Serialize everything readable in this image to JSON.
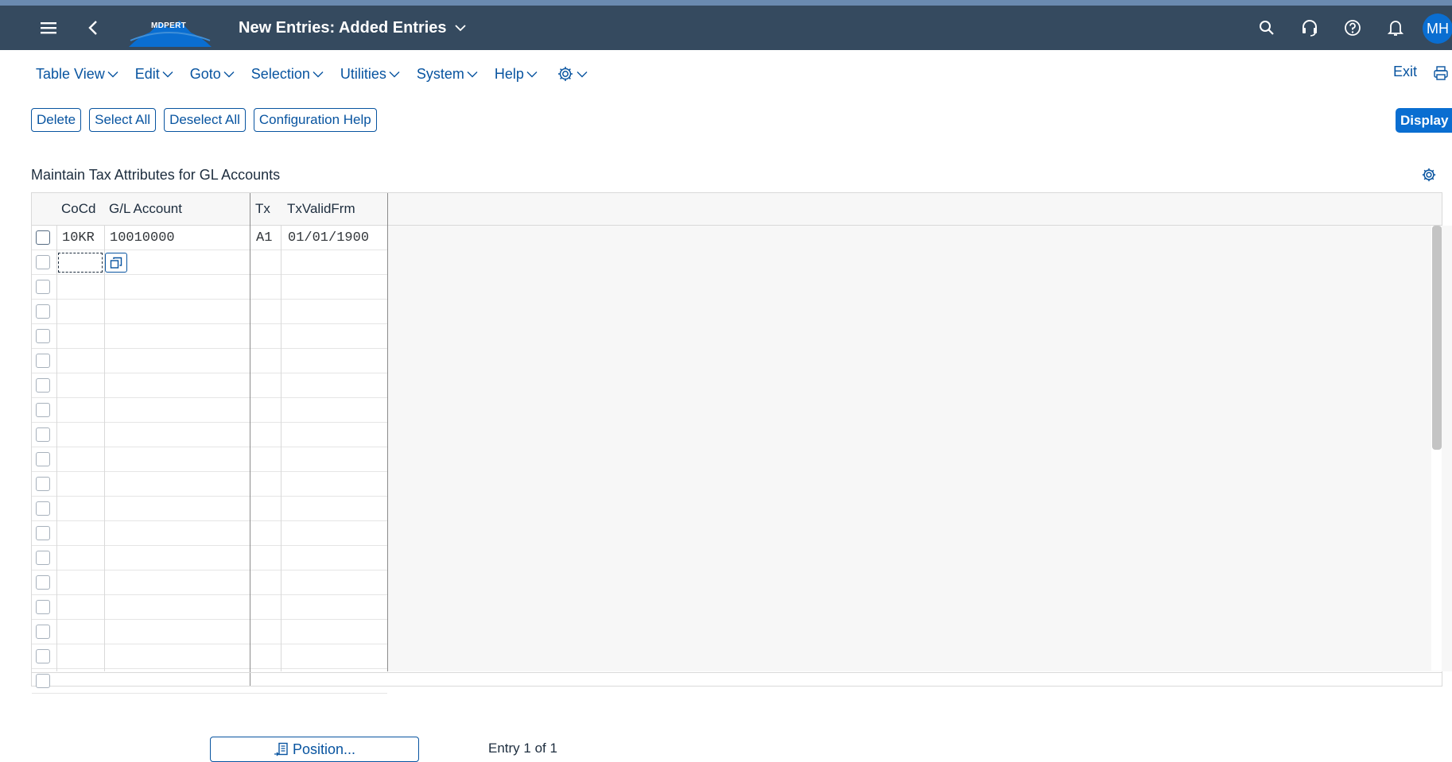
{
  "shell": {
    "title": "New Entries: Added Entries",
    "logo_text": "MDPERT",
    "user_initials": "MH",
    "icons": [
      "menu-icon",
      "back-icon",
      "search-icon",
      "headset-icon",
      "help-icon",
      "bell-icon"
    ]
  },
  "menu": {
    "items": [
      {
        "label": "Table View"
      },
      {
        "label": "Edit"
      },
      {
        "label": "Goto"
      },
      {
        "label": "Selection"
      },
      {
        "label": "Utilities"
      },
      {
        "label": "System"
      },
      {
        "label": "Help"
      }
    ],
    "settings_icon": "gear-icon",
    "exit_label": "Exit",
    "print_icon": "printer-icon"
  },
  "toolbar": {
    "delete_label": "Delete",
    "select_all_label": "Select All",
    "deselect_all_label": "Deselect All",
    "config_help_label": "Configuration Help",
    "display_label": "Display"
  },
  "table": {
    "title": "Maintain Tax Attributes for GL Accounts",
    "columns": [
      "CoCd",
      "G/L Account",
      "Tx",
      "TxValidFrm"
    ],
    "rows": [
      {
        "cocd": "10KR",
        "gl_account": "10010000",
        "tx": "A1",
        "valid_from": "01/01/1900"
      }
    ],
    "empty_row_count": 17
  },
  "footer": {
    "position_label": "Position...",
    "entry_info": "Entry 1 of 1"
  },
  "colors": {
    "shell_bg": "#354a5f",
    "accent": "#0854a0",
    "primary_button": "#0a6ed1"
  }
}
